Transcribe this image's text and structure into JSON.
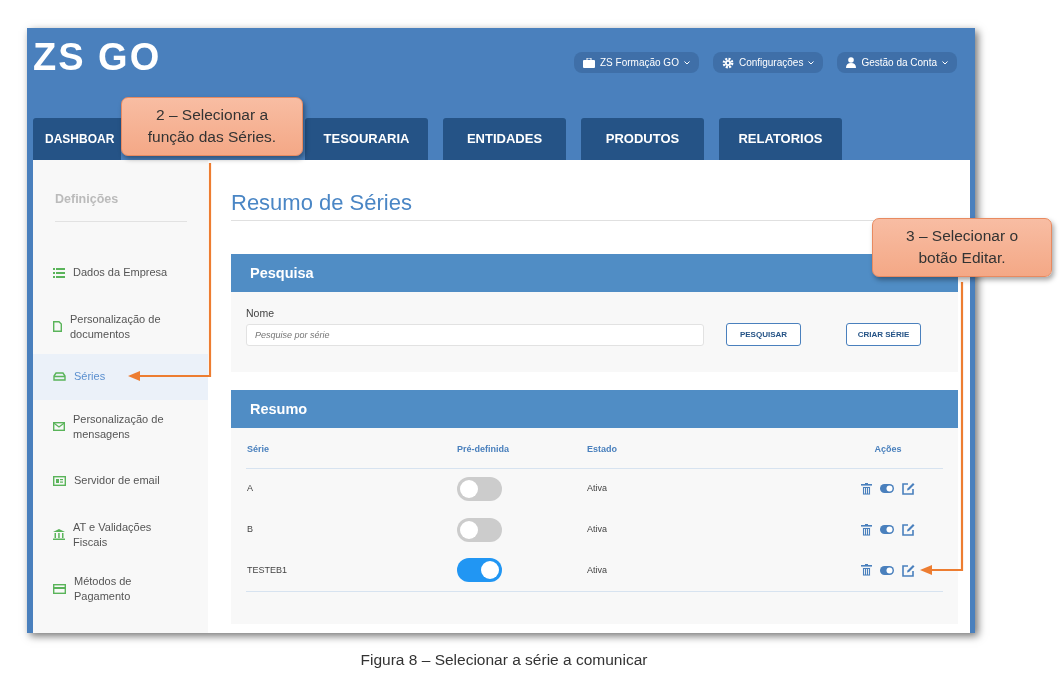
{
  "header": {
    "logo": "ZS GO",
    "menus": [
      "ZS Formação GO",
      "Configurações",
      "Gestão da Conta"
    ]
  },
  "tabs": [
    "DASHBOAR",
    "TESOURARIA",
    "ENTIDADES",
    "PRODUTOS",
    "RELATORIOS"
  ],
  "sidebar": {
    "heading": "Definições",
    "items": [
      {
        "label": "Dados da Empresa",
        "selected": false
      },
      {
        "label": "Personalização de documentos",
        "selected": false
      },
      {
        "label": "Séries",
        "selected": true
      },
      {
        "label": "Personalização de mensagens",
        "selected": false
      },
      {
        "label": "Servidor de email",
        "selected": false
      },
      {
        "label": "AT e Validações Fiscais",
        "selected": false
      },
      {
        "label": "Métodos de Pagamento",
        "selected": false
      }
    ]
  },
  "page_title": "Resumo de Séries",
  "search_panel": {
    "title": "Pesquisa",
    "field_label": "Nome",
    "placeholder": "Pesquise por série",
    "buttons": [
      "PESQUISAR",
      "CRIAR SÉRIE"
    ]
  },
  "summary_panel": {
    "title": "Resumo",
    "columns": [
      "Série",
      "Pré-definida",
      "Estado",
      "Ações"
    ],
    "rows": [
      {
        "serie": "A",
        "default": false,
        "estado": "Ativa"
      },
      {
        "serie": "B",
        "default": false,
        "estado": "Ativa"
      },
      {
        "serie": "TESTEB1",
        "default": true,
        "estado": "Ativa"
      }
    ]
  },
  "annotations": [
    "2 – Selecionar a função das Séries.",
    "3 – Selecionar o botão Editar."
  ],
  "caption": "Figura 8 – Selecionar a série a comunicar"
}
